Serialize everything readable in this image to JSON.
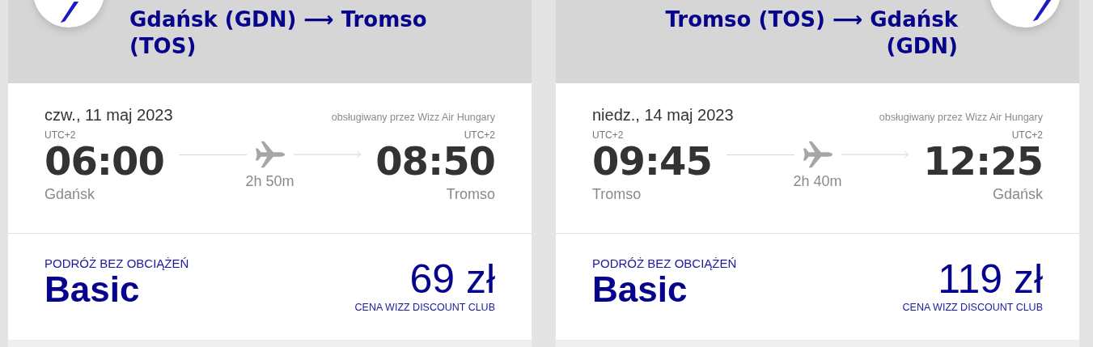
{
  "flights": [
    {
      "route": "Gdańsk (GDN) ⟶ Tromso (TOS)",
      "date": "czw., 11 maj 2023",
      "operator": "obsługiwany przez Wizz Air Hungary",
      "departure": {
        "timezone": "UTC+2",
        "time": "06:00",
        "city": "Gdańsk"
      },
      "arrival": {
        "timezone": "UTC+2",
        "time": "08:50",
        "city": "Tromso"
      },
      "duration": "2h 50m",
      "fare": {
        "label": "PODRÓŻ BEZ OBCIĄŻEŃ",
        "name": "Basic",
        "price": "69 zł",
        "note": "CENA WIZZ DISCOUNT CLUB"
      }
    },
    {
      "route": "Tromso (TOS) ⟶ Gdańsk (GDN)",
      "date": "niedz., 14 maj 2023",
      "operator": "obsługiwany przez Wizz Air Hungary",
      "departure": {
        "timezone": "UTC+2",
        "time": "09:45",
        "city": "Tromso"
      },
      "arrival": {
        "timezone": "UTC+2",
        "time": "12:25",
        "city": "Gdańsk"
      },
      "duration": "2h 40m",
      "fare": {
        "label": "PODRÓŻ BEZ OBCIĄŻEŃ",
        "name": "Basic",
        "price": "119 zł",
        "note": "CENA WIZZ DISCOUNT CLUB"
      }
    }
  ]
}
